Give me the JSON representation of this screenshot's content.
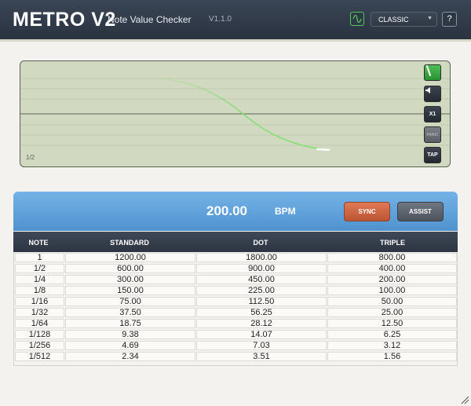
{
  "header": {
    "logo": "METRO V2",
    "subtitle": "Note Value Checker",
    "version": "V1.1.0",
    "preset": "CLASSIC",
    "help_label": "?",
    "accent_color": "#59c261"
  },
  "graph": {
    "label": "1/2",
    "buttons": {
      "x1": "X1",
      "panic": "PANIC",
      "tap": "TAP"
    }
  },
  "bpm_panel": {
    "value": "200.00",
    "unit": "BPM",
    "sync_label": "SYNC",
    "assist_label": "ASSIST"
  },
  "table": {
    "headers": [
      "NOTE",
      "STANDARD",
      "DOT",
      "TRIPLE"
    ],
    "rows": [
      [
        "1",
        "1200.00",
        "1800.00",
        "800.00"
      ],
      [
        "1/2",
        "600.00",
        "900.00",
        "400.00"
      ],
      [
        "1/4",
        "300.00",
        "450.00",
        "200.00"
      ],
      [
        "1/8",
        "150.00",
        "225.00",
        "100.00"
      ],
      [
        "1/16",
        "75.00",
        "112.50",
        "50.00"
      ],
      [
        "1/32",
        "37.50",
        "56.25",
        "25.00"
      ],
      [
        "1/64",
        "18.75",
        "28.12",
        "12.50"
      ],
      [
        "1/128",
        "9.38",
        "14.07",
        "6.25"
      ],
      [
        "1/256",
        "4.69",
        "7.03",
        "3.12"
      ],
      [
        "1/512",
        "2.34",
        "3.51",
        "1.56"
      ]
    ]
  }
}
